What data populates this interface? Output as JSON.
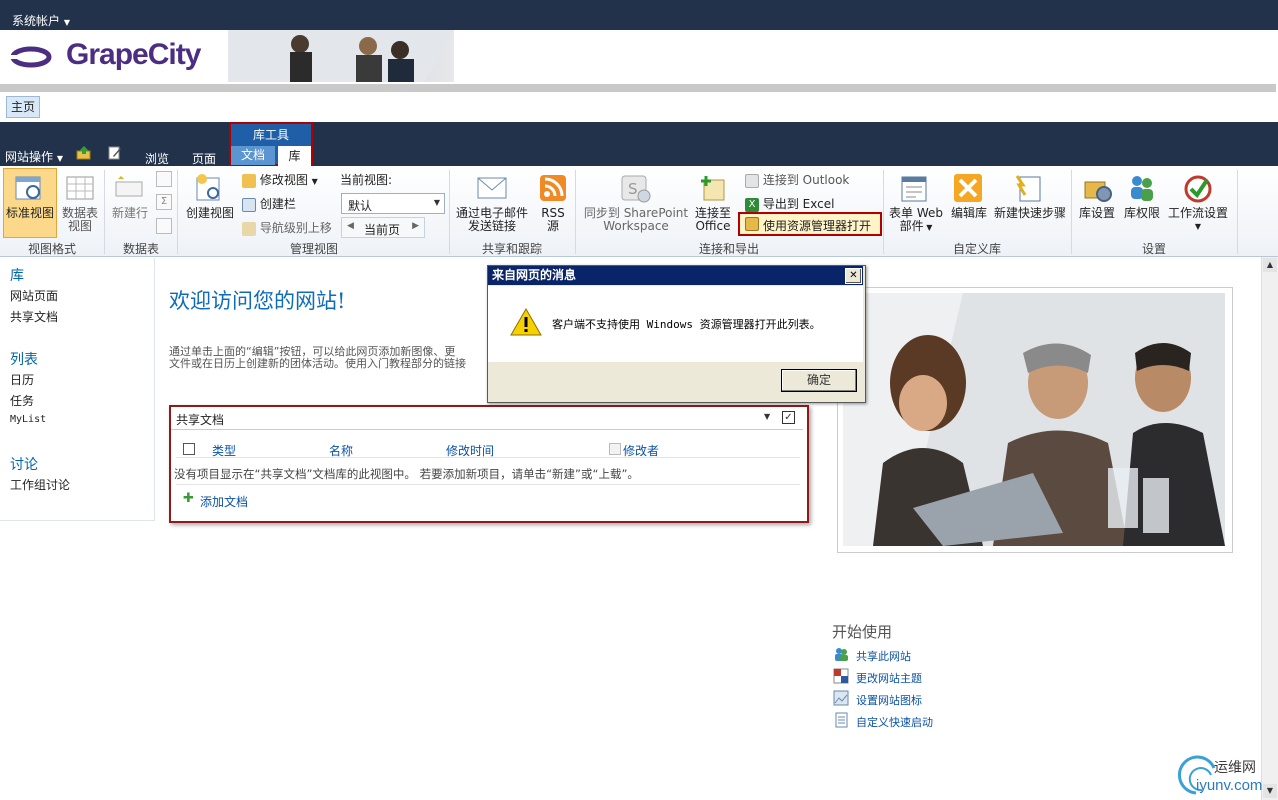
{
  "topbar": {
    "account_label": "系统帐户"
  },
  "header": {
    "logo_text": "GrapeCity"
  },
  "nav_tabs": {
    "home": "主页"
  },
  "ribbon_tabs": {
    "site_actions": "网站操作",
    "browse": "浏览",
    "page": "页面",
    "library_tools": "库工具",
    "documents": "文档",
    "library": "库"
  },
  "ribbon": {
    "view_format": {
      "group_label": "视图格式",
      "standard_view": "标准视图",
      "datasheet_view_line1": "数据表",
      "datasheet_view_line2": "视图"
    },
    "datasheet": {
      "group_label": "数据表",
      "new_row": "新建行"
    },
    "manage_views": {
      "group_label": "管理视图",
      "create_view": "创建视图",
      "modify_view": "修改视图",
      "create_column": "创建栏",
      "navigate_up": "导航级别上移",
      "current_view_label": "当前视图:",
      "current_view_value": "默认",
      "current_page": "当前页"
    },
    "share_track": {
      "group_label": "共享和跟踪",
      "email_link_line1": "通过电子邮件",
      "email_link_line2": "发送链接",
      "rss_line1": "RSS",
      "rss_line2": "源"
    },
    "connect_export": {
      "group_label": "连接和导出",
      "sync_line1": "同步到 SharePoint",
      "sync_line2": "Workspace",
      "connect_office_line1": "连接至",
      "connect_office_line2": "Office",
      "connect_outlook": "连接到 Outlook",
      "export_excel": "导出到 Excel",
      "open_explorer": "使用资源管理器打开"
    },
    "customize_library": {
      "group_label": "自定义库",
      "form_web_line1": "表单 Web",
      "form_web_line2": "部件",
      "edit_library": "编辑库",
      "new_quick_step": "新建快速步骤"
    },
    "settings": {
      "group_label": "设置",
      "library_settings": "库设置",
      "library_permissions": "库权限",
      "workflow_settings": "工作流设置"
    }
  },
  "leftnav": {
    "libraries_heading": "库",
    "libraries": [
      "网站页面",
      "共享文档"
    ],
    "lists_heading": "列表",
    "lists": [
      "日历",
      "任务",
      "MyList"
    ],
    "discussions_heading": "讨论",
    "discussions": [
      "工作组讨论"
    ]
  },
  "main": {
    "welcome": "欢迎访问您的网站!",
    "intro_line1": "通过单击上面的“编辑”按钮，可以给此网页添加新图像、更",
    "intro_line2": "文件或在日历上创建新的团体活动。使用入门教程部分的链接"
  },
  "webpart": {
    "title": "共享文档",
    "columns": {
      "type": "类型",
      "name": "名称",
      "modified": "修改时间",
      "modified_by": "修改者"
    },
    "empty_message": "没有项目显示在“共享文档”文档库的此视图中。 若要添加新项目，请单击“新建”或“上载”。",
    "add_document": "添加文档"
  },
  "dialog": {
    "title": "来自网页的消息",
    "message": "客户端不支持使用 Windows 资源管理器打开此列表。",
    "ok": "确定",
    "close_glyph": "✕"
  },
  "getting_started": {
    "title": "开始使用",
    "links": [
      "共享此网站",
      "更改网站主题",
      "设置网站图标",
      "自定义快速启动"
    ]
  },
  "watermark": {
    "line1": "运维网",
    "line2": "iyunv.com"
  },
  "colors": {
    "topbar": "#21324a",
    "accent_red": "#b00000",
    "link_blue": "#0a52a6",
    "title_blue": "#0f6cb8"
  }
}
